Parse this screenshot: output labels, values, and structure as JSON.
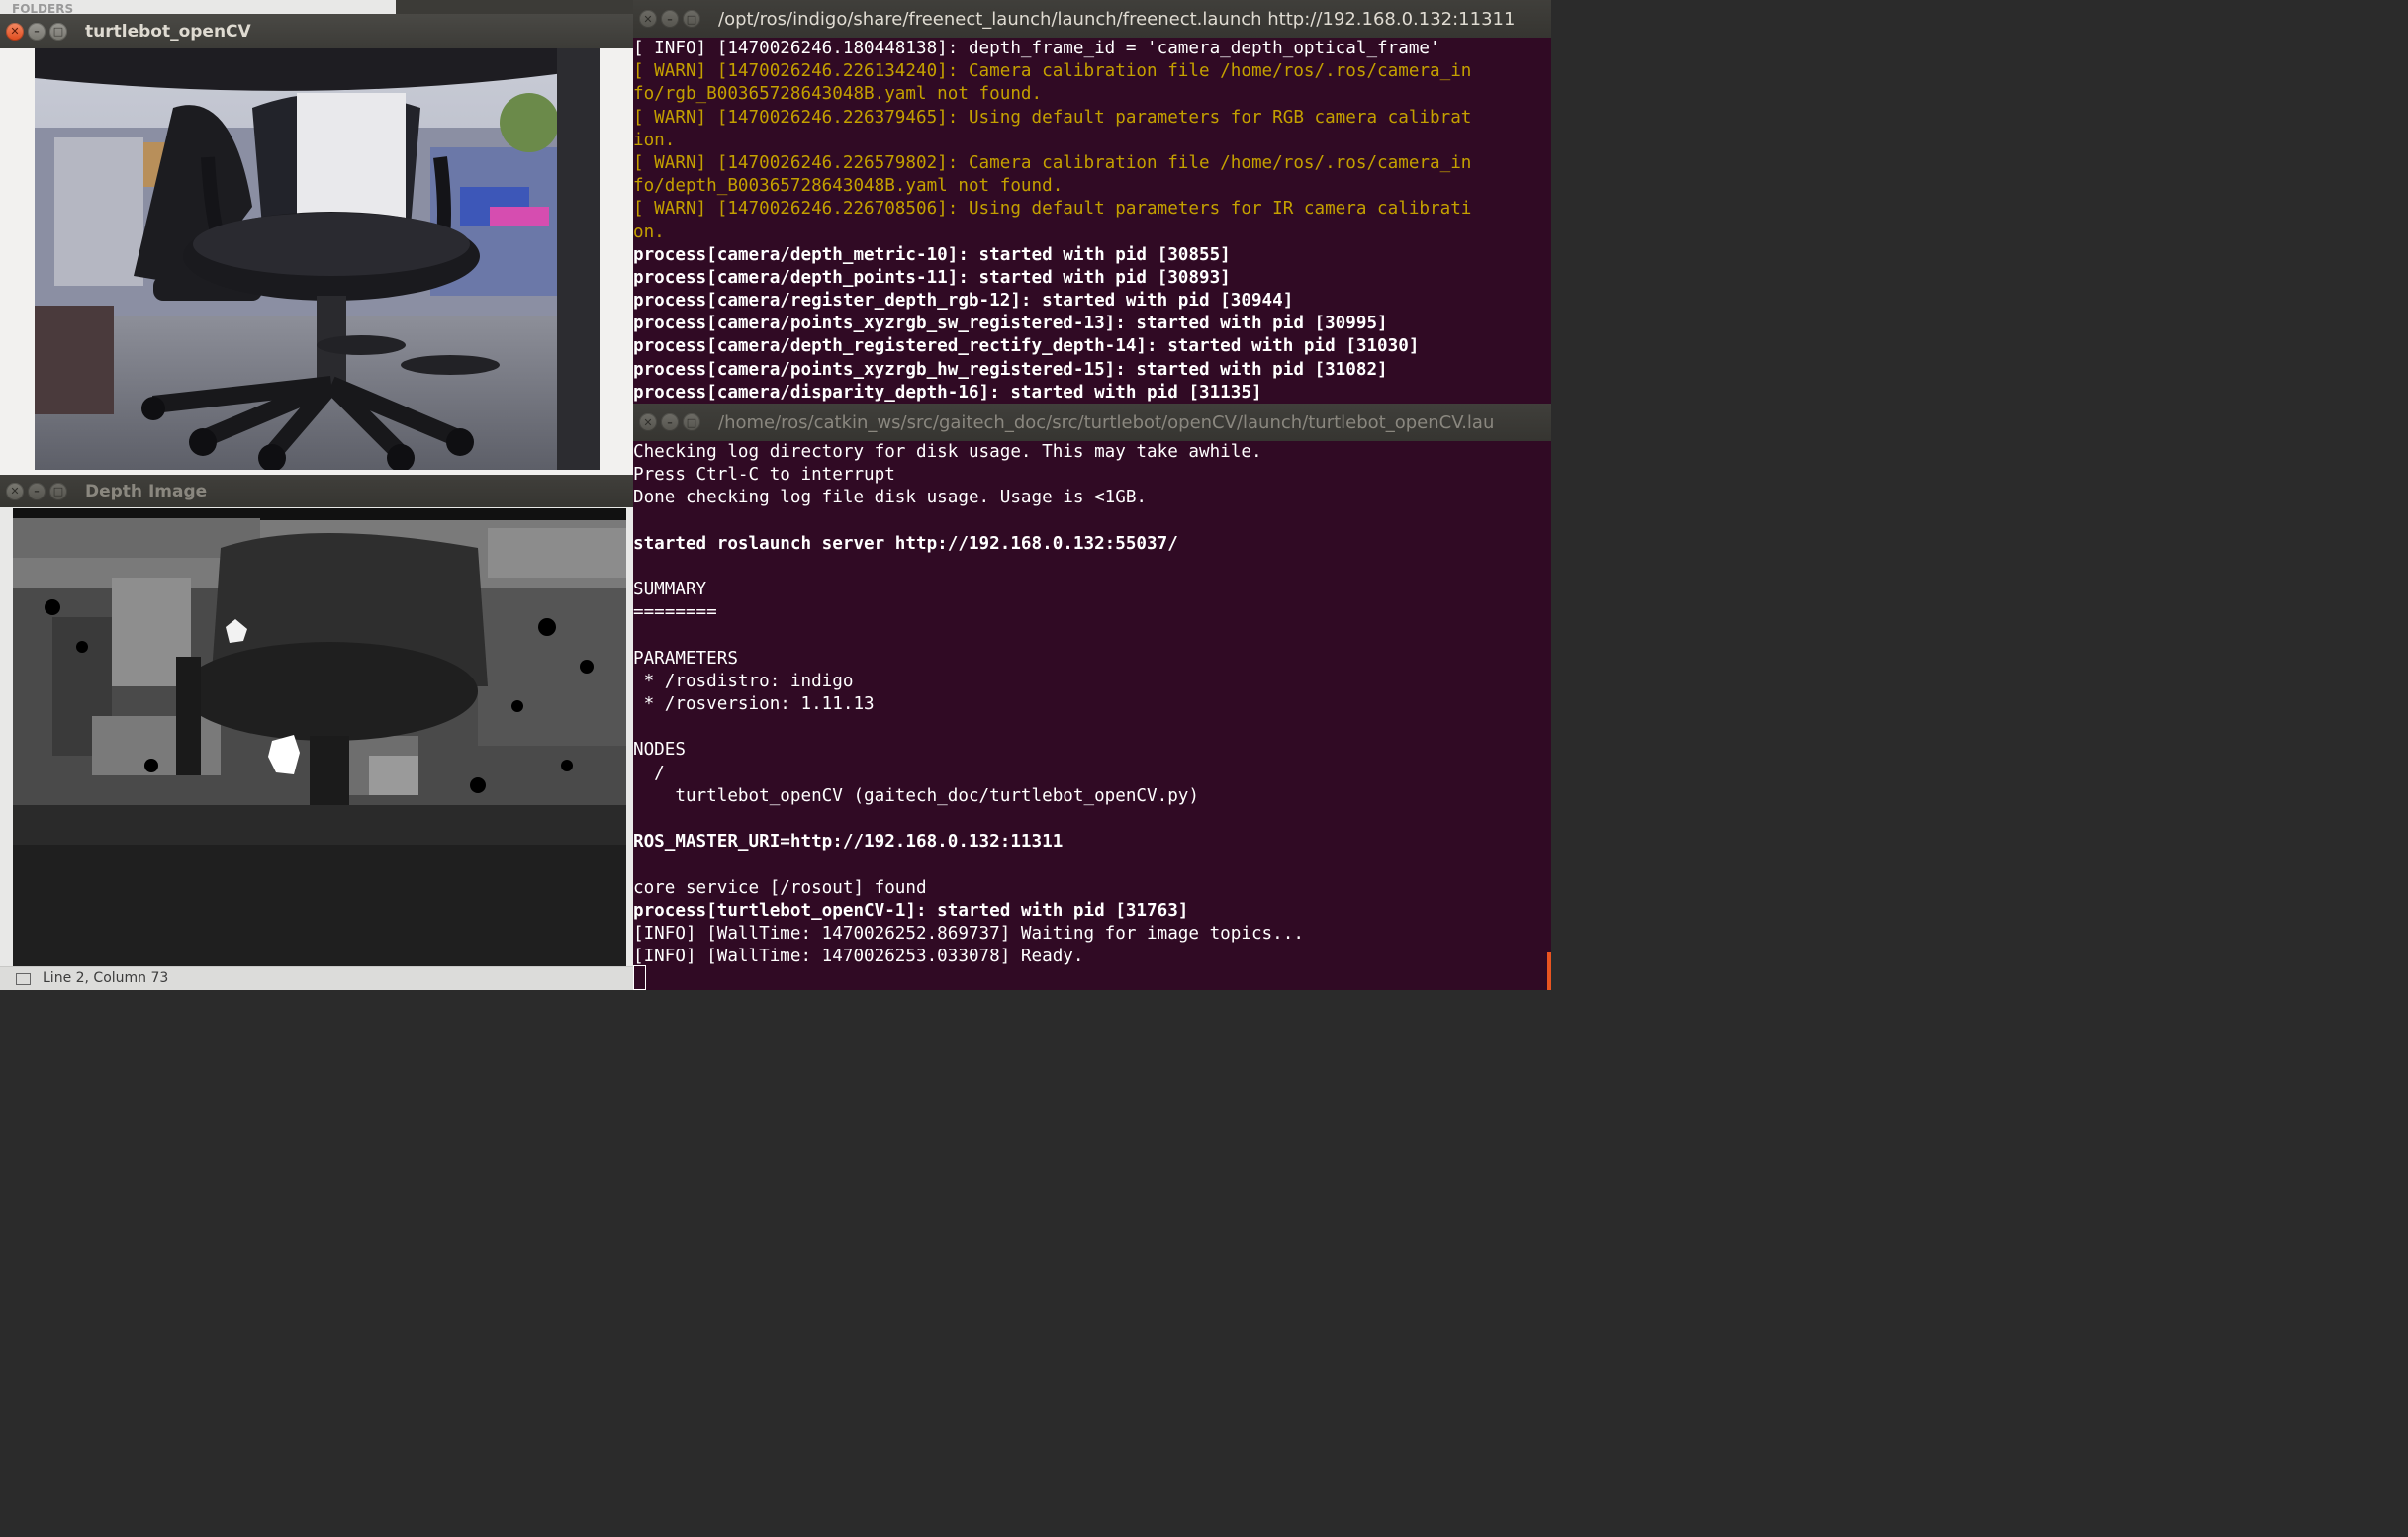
{
  "background_window": {
    "folders_label": "FOLDERS"
  },
  "camera_window": {
    "title": "turtlebot_openCV"
  },
  "depth_window": {
    "title": "Depth Image",
    "status": "Line 2, Column 73"
  },
  "terminal1": {
    "title": "/opt/ros/indigo/share/freenect_launch/launch/freenect.launch http://192.168.0.132:11311",
    "lines": [
      {
        "text": "[ INFO] [1470026246.180448138]: depth_frame_id = 'camera_depth_optical_frame'",
        "style": "info"
      },
      {
        "text": "[ WARN] [1470026246.226134240]: Camera calibration file /home/ros/.ros/camera_in",
        "style": "warn"
      },
      {
        "text": "fo/rgb_B00365728643048B.yaml not found.",
        "style": "warn"
      },
      {
        "text": "[ WARN] [1470026246.226379465]: Using default parameters for RGB camera calibrat",
        "style": "warn"
      },
      {
        "text": "ion.",
        "style": "warn"
      },
      {
        "text": "[ WARN] [1470026246.226579802]: Camera calibration file /home/ros/.ros/camera_in",
        "style": "warn"
      },
      {
        "text": "fo/depth_B00365728643048B.yaml not found.",
        "style": "warn"
      },
      {
        "text": "[ WARN] [1470026246.226708506]: Using default parameters for IR camera calibrati",
        "style": "warn"
      },
      {
        "text": "on.",
        "style": "warn"
      },
      {
        "text": "process[camera/depth_metric-10]: started with pid [30855]",
        "style": "bold"
      },
      {
        "text": "process[camera/depth_points-11]: started with pid [30893]",
        "style": "bold"
      },
      {
        "text": "process[camera/register_depth_rgb-12]: started with pid [30944]",
        "style": "bold"
      },
      {
        "text": "process[camera/points_xyzrgb_sw_registered-13]: started with pid [30995]",
        "style": "bold"
      },
      {
        "text": "process[camera/depth_registered_rectify_depth-14]: started with pid [31030]",
        "style": "bold"
      },
      {
        "text": "process[camera/points_xyzrgb_hw_registered-15]: started with pid [31082]",
        "style": "bold"
      },
      {
        "text": "process[camera/disparity_depth-16]: started with pid [31135]",
        "style": "bold"
      }
    ]
  },
  "terminal2": {
    "title": "/home/ros/catkin_ws/src/gaitech_doc/src/turtlebot/openCV/launch/turtlebot_openCV.lau",
    "lines": [
      {
        "text": "Checking log directory for disk usage. This may take awhile.",
        "style": "normal"
      },
      {
        "text": "Press Ctrl-C to interrupt",
        "style": "normal"
      },
      {
        "text": "Done checking log file disk usage. Usage is <1GB.",
        "style": "normal"
      },
      {
        "text": "",
        "style": "normal"
      },
      {
        "text": "started roslaunch server http://192.168.0.132:55037/",
        "style": "bold"
      },
      {
        "text": "",
        "style": "normal"
      },
      {
        "text": "SUMMARY",
        "style": "normal"
      },
      {
        "text": "========",
        "style": "normal"
      },
      {
        "text": "",
        "style": "normal"
      },
      {
        "text": "PARAMETERS",
        "style": "normal"
      },
      {
        "text": " * /rosdistro: indigo",
        "style": "normal"
      },
      {
        "text": " * /rosversion: 1.11.13",
        "style": "normal"
      },
      {
        "text": "",
        "style": "normal"
      },
      {
        "text": "NODES",
        "style": "normal"
      },
      {
        "text": "  /",
        "style": "normal"
      },
      {
        "text": "    turtlebot_openCV (gaitech_doc/turtlebot_openCV.py)",
        "style": "normal"
      },
      {
        "text": "",
        "style": "normal"
      },
      {
        "text": "ROS_MASTER_URI=http://192.168.0.132:11311",
        "style": "bold"
      },
      {
        "text": "",
        "style": "normal"
      },
      {
        "text": "core service [/rosout] found",
        "style": "normal"
      },
      {
        "text": "process[turtlebot_openCV-1]: started with pid [31763]",
        "style": "bold"
      },
      {
        "text": "[INFO] [WallTime: 1470026252.869737] Waiting for image topics...",
        "style": "normal"
      },
      {
        "text": "[INFO] [WallTime: 1470026253.033078] Ready.",
        "style": "normal"
      }
    ]
  },
  "colors": {
    "terminal_bg": "#300a24",
    "warn_text": "#c4a000",
    "close_button": "#df4a1c"
  }
}
